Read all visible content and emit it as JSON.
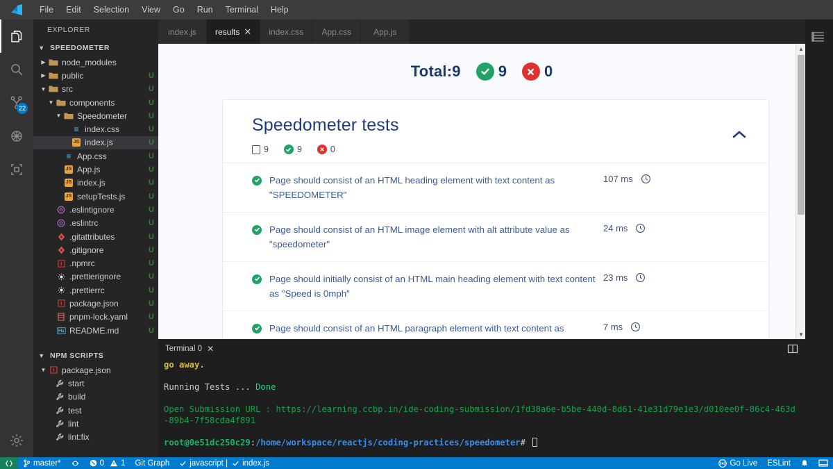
{
  "menubar": {
    "logo_icon": "vscode-logo-icon",
    "items": [
      "File",
      "Edit",
      "Selection",
      "View",
      "Go",
      "Run",
      "Terminal",
      "Help"
    ]
  },
  "activitybar": {
    "items": [
      {
        "name": "explorer",
        "icon": "files-icon",
        "badge": ""
      },
      {
        "name": "search",
        "icon": "search-icon",
        "badge": ""
      },
      {
        "name": "source-control",
        "icon": "source-control-icon",
        "badge": "22"
      },
      {
        "name": "run-and-debug",
        "icon": "debug-icon",
        "badge": ""
      },
      {
        "name": "extensions",
        "icon": "extensions-icon",
        "badge": ""
      }
    ],
    "settings_icon": "gear-icon"
  },
  "sidebar": {
    "title": "EXPLORER",
    "project": {
      "label": "SPEEDOMETER",
      "expanded": true
    },
    "tree": [
      {
        "label": "node_modules",
        "type": "folder",
        "indent": 1,
        "twisty": "collapsed",
        "status": ""
      },
      {
        "label": "public",
        "type": "folder",
        "indent": 1,
        "twisty": "collapsed",
        "status": "U"
      },
      {
        "label": "src",
        "type": "folder",
        "indent": 1,
        "twisty": "expanded",
        "status": "U"
      },
      {
        "label": "components",
        "type": "folder",
        "indent": 2,
        "twisty": "expanded",
        "status": "U"
      },
      {
        "label": "Speedometer",
        "type": "folder",
        "indent": 3,
        "twisty": "expanded",
        "status": "U"
      },
      {
        "label": "index.css",
        "type": "css",
        "indent": 4,
        "twisty": "",
        "status": "U"
      },
      {
        "label": "index.js",
        "type": "js",
        "indent": 4,
        "twisty": "",
        "status": "U",
        "selected": true
      },
      {
        "label": "App.css",
        "type": "css",
        "indent": 3,
        "twisty": "",
        "status": "U"
      },
      {
        "label": "App.js",
        "type": "js",
        "indent": 3,
        "twisty": "",
        "status": "U"
      },
      {
        "label": "index.js",
        "type": "js",
        "indent": 3,
        "twisty": "",
        "status": "U"
      },
      {
        "label": "setupTests.js",
        "type": "js",
        "indent": 3,
        "twisty": "",
        "status": "U"
      },
      {
        "label": ".eslintignore",
        "type": "eslint",
        "indent": 2,
        "twisty": "",
        "status": "U"
      },
      {
        "label": ".eslintrc",
        "type": "eslint",
        "indent": 2,
        "twisty": "",
        "status": "U"
      },
      {
        "label": ".gitattributes",
        "type": "git",
        "indent": 2,
        "twisty": "",
        "status": "U"
      },
      {
        "label": ".gitignore",
        "type": "git",
        "indent": 2,
        "twisty": "",
        "status": "U"
      },
      {
        "label": ".npmrc",
        "type": "npm",
        "indent": 2,
        "twisty": "",
        "status": "U"
      },
      {
        "label": ".prettierignore",
        "type": "prettier",
        "indent": 2,
        "twisty": "",
        "status": "U"
      },
      {
        "label": ".prettierrc",
        "type": "prettier",
        "indent": 2,
        "twisty": "",
        "status": "U"
      },
      {
        "label": "package.json",
        "type": "npm",
        "indent": 2,
        "twisty": "",
        "status": "U"
      },
      {
        "label": "pnpm-lock.yaml",
        "type": "yaml",
        "indent": 2,
        "twisty": "",
        "status": "U"
      },
      {
        "label": "README.md",
        "type": "md",
        "indent": 2,
        "twisty": "",
        "status": "U"
      }
    ],
    "npm_scripts": {
      "title": "NPM SCRIPTS",
      "package_label": "package.json",
      "scripts": [
        "start",
        "build",
        "test",
        "lint",
        "lint:fix"
      ]
    }
  },
  "tabs": {
    "items": [
      {
        "label": "index.js",
        "active": false,
        "closable": false
      },
      {
        "label": "results",
        "active": true,
        "closable": true
      },
      {
        "label": "index.css",
        "active": false,
        "closable": false
      },
      {
        "label": "App.css",
        "active": false,
        "closable": false
      },
      {
        "label": "App.js",
        "active": false,
        "closable": false
      }
    ],
    "action_icon": "open-preview-icon",
    "outline_icon": "outline-list-icon"
  },
  "results": {
    "total_label": "Total:9",
    "passed_count": "9",
    "failed_count": "0",
    "suite": {
      "title": "Speedometer tests",
      "collapse_icon": "chevron-up-icon",
      "total_count": "9",
      "passed_count": "9",
      "failed_count": "0"
    },
    "tests": [
      {
        "status": "passed",
        "name": "Page should consist of an HTML heading element with text content as \"SPEEDOMETER\"",
        "time": "107 ms"
      },
      {
        "status": "passed",
        "name": "Page should consist of an HTML image element with alt attribute value as \"speedometer\"",
        "time": "24 ms"
      },
      {
        "status": "passed",
        "name": "Page should initially consist of an HTML main heading element with text content as \"Speed is 0mph\"",
        "time": "23 ms"
      },
      {
        "status": "passed",
        "name": "Page should consist of an HTML paragraph element with text content as",
        "time": "7 ms"
      }
    ],
    "colors": {
      "pass": "#21a366",
      "fail": "#e03131",
      "title": "#1f3d7a",
      "link": "#3b5a9a"
    }
  },
  "panel": {
    "tab_label": "Terminal 0",
    "close_icon": "close-icon",
    "split_icon": "split-panel-icon",
    "lines": [
      {
        "segments": [
          {
            "text": "go away.",
            "color": "yellow"
          }
        ]
      },
      {
        "segments": [
          {
            "text": "",
            "color": "white"
          }
        ]
      },
      {
        "segments": [
          {
            "text": "Running Tests ... ",
            "color": "white"
          },
          {
            "text": "Done",
            "color": "green"
          }
        ]
      },
      {
        "segments": [
          {
            "text": "",
            "color": "white"
          }
        ]
      },
      {
        "segments": [
          {
            "text": "Open Submission URL : https://learning.ccbp.in/ide-coding-submission/1fd38a6e-b5be-440d-8d61-41e31d79e1e3/d010ee0f-86c4-463d-89b4-7f58cda4f891",
            "color": "darkgreen"
          }
        ]
      },
      {
        "segments": [
          {
            "text": "",
            "color": "white"
          }
        ]
      },
      {
        "segments": [
          {
            "text": "root@0e51dc250c29",
            "color": "promptgreen"
          },
          {
            "text": ":",
            "color": "white"
          },
          {
            "text": "/home/workspace/reactjs/coding-practices/speedometer",
            "color": "blue"
          },
          {
            "text": "# ",
            "color": "white"
          }
        ],
        "cursor": true
      }
    ]
  },
  "statusbar": {
    "left": [
      {
        "icon": "remote-icon",
        "label": "",
        "name": "remote-indicator"
      },
      {
        "icon": "branch-icon",
        "label": "master*",
        "name": "git-branch"
      },
      {
        "icon": "sync-icon",
        "label": "",
        "name": "sync-changes"
      },
      {
        "icon": "error-icon",
        "label": "0",
        "name": "errors-count"
      },
      {
        "icon": "warning-icon",
        "label": "1",
        "name": "warnings-count"
      },
      {
        "icon": "",
        "label": "Git Graph",
        "name": "git-graph"
      },
      {
        "icon": "check-icon",
        "label": "javascript |",
        "name": "eslint-javascript"
      },
      {
        "icon": "check-icon",
        "label": "index.js",
        "name": "eslint-file"
      }
    ],
    "right": [
      {
        "icon": "broadcast-icon",
        "label": "Go Live",
        "name": "go-live"
      },
      {
        "icon": "",
        "label": "ESLint",
        "name": "eslint-status"
      },
      {
        "icon": "bell-icon",
        "label": "",
        "name": "notifications"
      },
      {
        "icon": "feedback-icon",
        "label": "",
        "name": "open-panel"
      }
    ]
  }
}
